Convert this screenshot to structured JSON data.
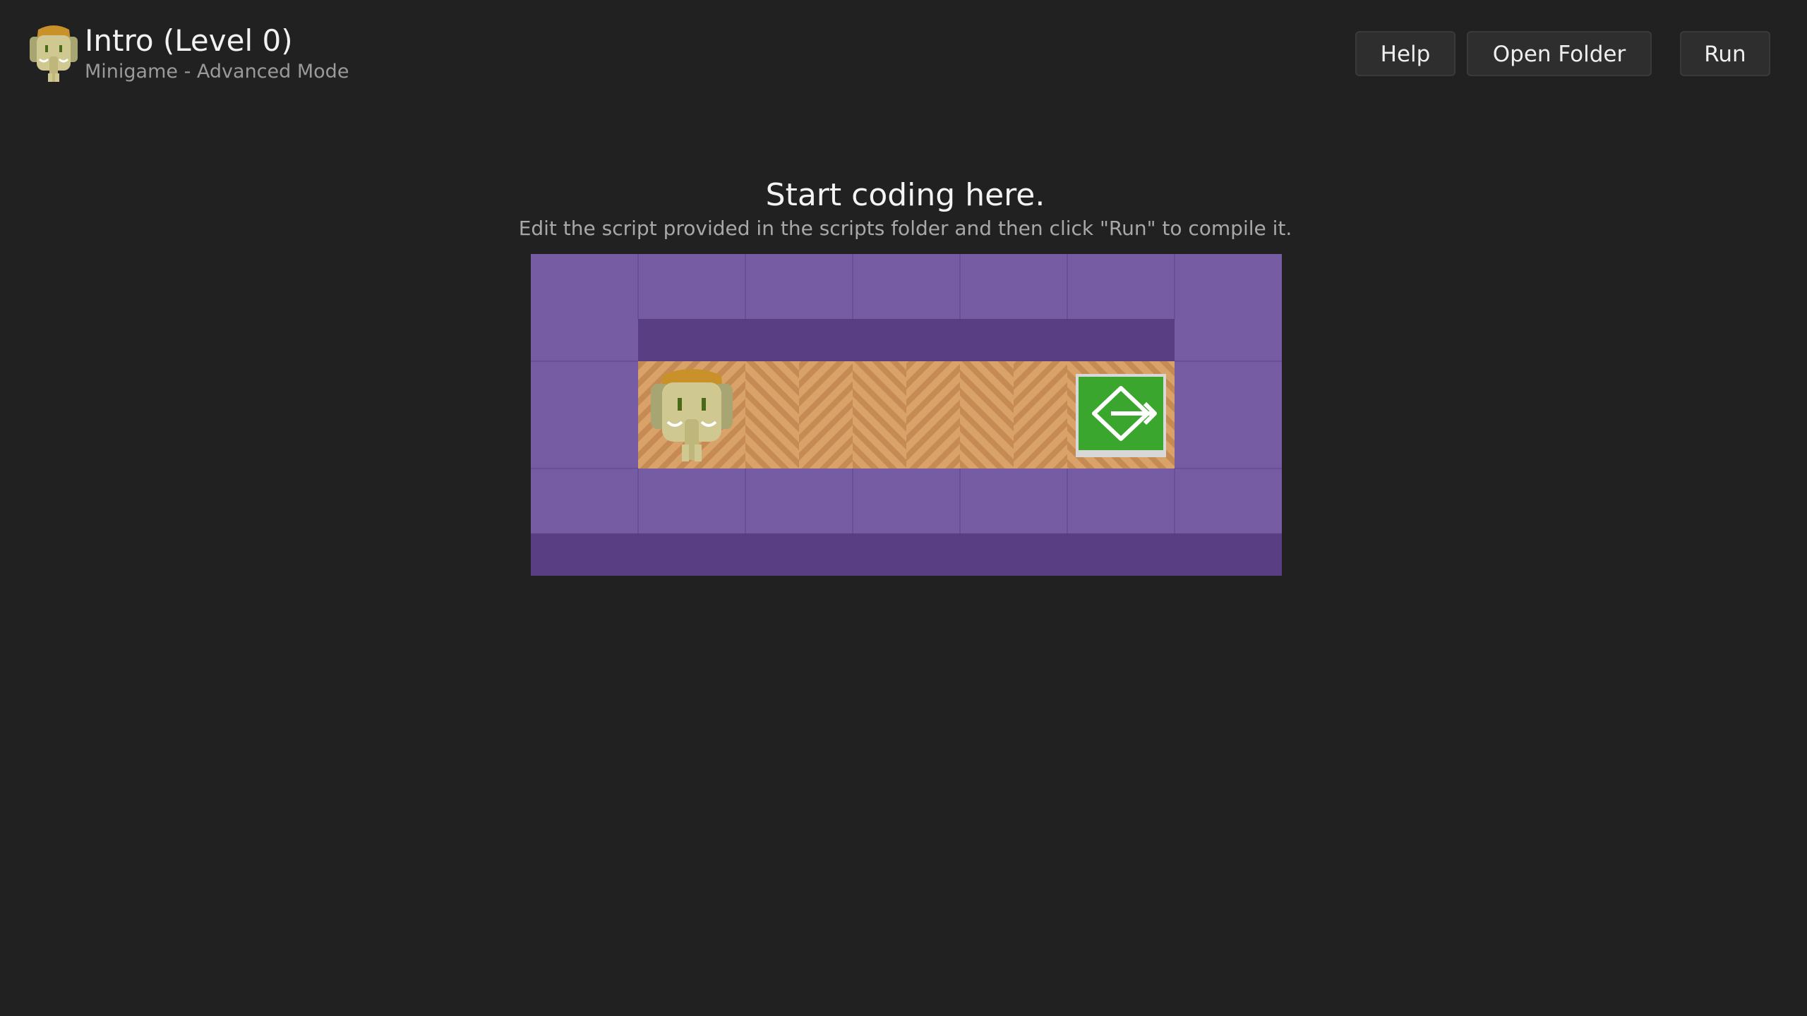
{
  "header": {
    "title": "Intro (Level 0)",
    "subtitle": "Minigame - Advanced Mode",
    "icon": "elephant-avatar-icon"
  },
  "toolbar": {
    "help_label": "Help",
    "open_folder_label": "Open Folder",
    "run_label": "Run"
  },
  "main": {
    "heading": "Start coding here.",
    "instruction": "Edit the script provided in the scripts folder and then click \"Run\" to compile it."
  },
  "board": {
    "columns": 7,
    "rows": 3,
    "player": {
      "name": "elephant-player",
      "column": 2,
      "row": 2
    },
    "exit": {
      "name": "exit-door-icon",
      "column": 6,
      "row": 2
    },
    "colors": {
      "wall": "#765ca3",
      "wall_shadow": "#5a3e83",
      "floor": "#d49a60",
      "exit": "#3aa62e",
      "background": "#212121"
    }
  }
}
